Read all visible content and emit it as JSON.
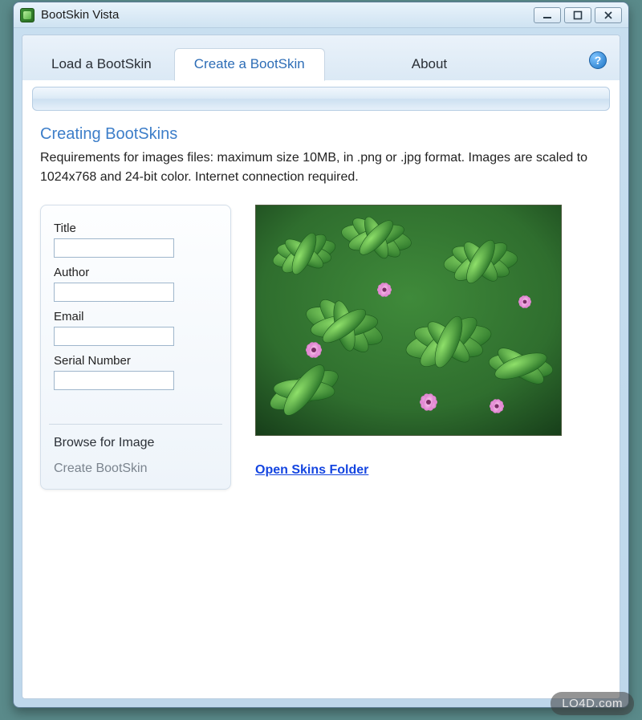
{
  "window": {
    "title": "BootSkin Vista"
  },
  "tabs": {
    "load": {
      "label": "Load a BootSkin"
    },
    "create": {
      "label": "Create a BootSkin"
    },
    "about": {
      "label": "About"
    }
  },
  "help_icon_glyph": "?",
  "section": {
    "title": "Creating BootSkins",
    "desc": "Requirements for images files: maximum size 10MB, in .png or .jpg format. Images are scaled to 1024x768 and 24-bit color.   Internet connection required."
  },
  "form": {
    "title": {
      "label": "Title",
      "value": ""
    },
    "author": {
      "label": "Author",
      "value": ""
    },
    "email": {
      "label": "Email",
      "value": ""
    },
    "serial": {
      "label": "Serial Number",
      "value": ""
    },
    "browse": "Browse for Image",
    "create": "Create BootSkin"
  },
  "preview": {
    "alt": "Green ferns with small pink flowers"
  },
  "links": {
    "open_folder": "Open Skins Folder"
  },
  "watermark": "LO4D.com"
}
